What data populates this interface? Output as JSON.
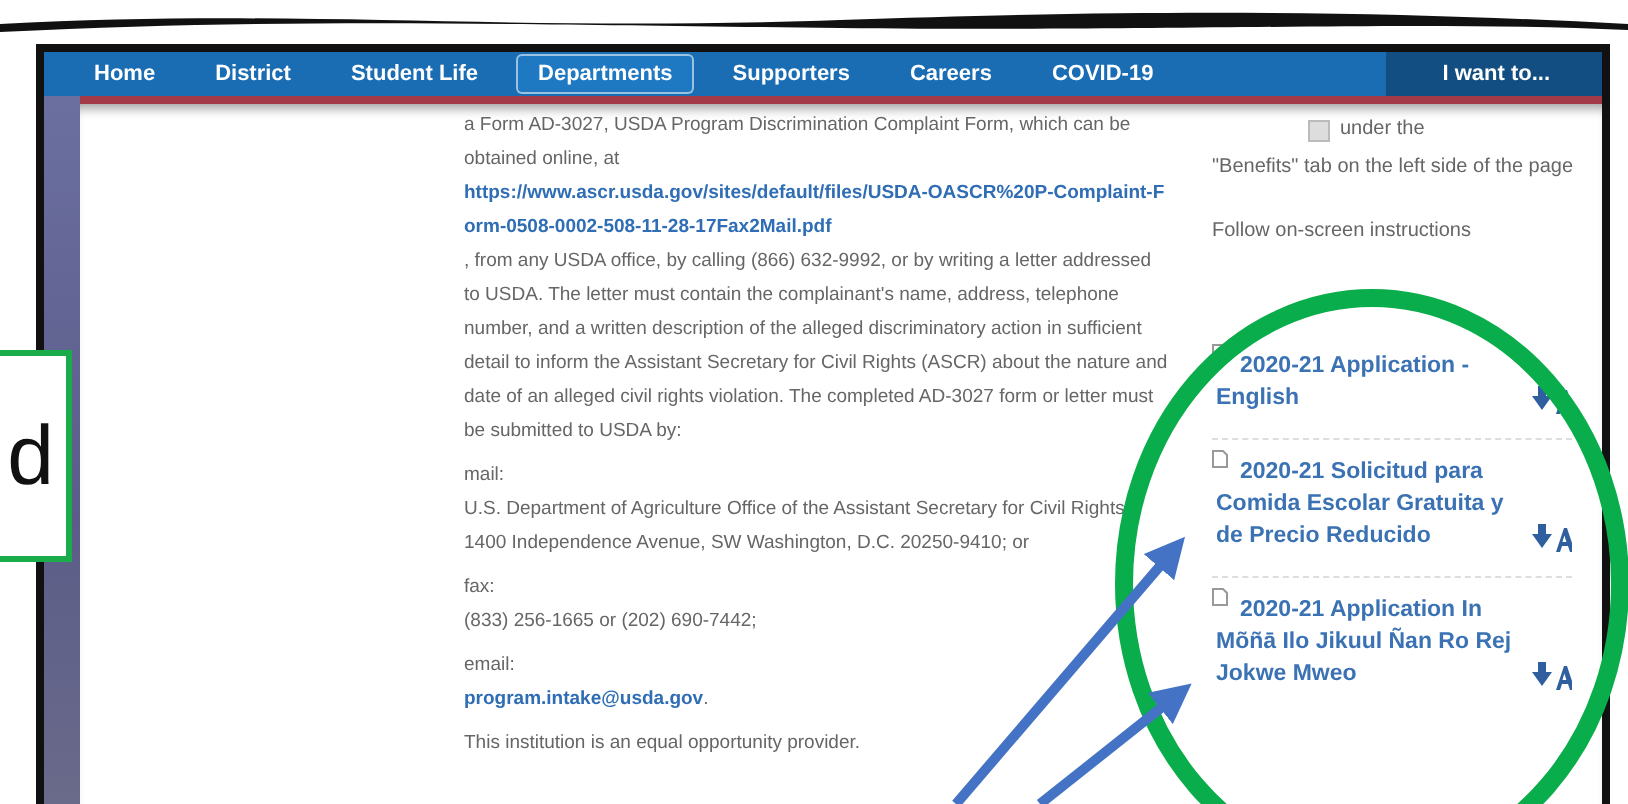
{
  "nav": {
    "items": [
      {
        "label": "Home",
        "selected": false
      },
      {
        "label": "District",
        "selected": false
      },
      {
        "label": "Student Life",
        "selected": false
      },
      {
        "label": "Departments",
        "selected": true
      },
      {
        "label": "Supporters",
        "selected": false
      },
      {
        "label": "Careers",
        "selected": false
      },
      {
        "label": "COVID-19",
        "selected": false
      }
    ],
    "menu_button": "I want to..."
  },
  "main": {
    "intro": {
      "text_before": "a Form AD-3027, USDA Program Discrimination Complaint Form, which can be obtained online, at",
      "link": "https://www.ascr.usda.gov/sites/default/files/USDA-OASCR%20P-Complaint-Form-0508-0002-508-11-28-17Fax2Mail.pdf",
      "text_after": ", from any USDA office, by calling (866) 632-9992, or by writing a letter addressed to USDA. The letter must contain the complainant's name, address, telephone number, and a written description of the alleged discriminatory action in sufficient detail to inform the Assistant Secretary for Civil Rights (ASCR) about the nature and date of an alleged civil rights violation.  The completed AD-3027 form or letter must be submitted to USDA by:"
    },
    "contacts": [
      {
        "label": "mail:",
        "kind": "text",
        "value": "U.S. Department of Agriculture  Office of the Assistant Secretary for Civil Rights  1400 Independence Avenue, SW  Washington, D.C. 20250-9410; or"
      },
      {
        "label": "fax:",
        "kind": "text",
        "value": "(833) 256-1665 or (202) 690-7442;"
      },
      {
        "label": "email:",
        "kind": "link",
        "value": "program.intake@usda.gov",
        "suffix": "."
      }
    ],
    "closing": "This institution is an equal opportunity provider."
  },
  "sidebar": {
    "step_text": "under the",
    "step_text_2": "\"Benefits\" tab on the left side of the page",
    "instructions": "Follow on-screen instructions",
    "downloads": [
      {
        "title": "2020-21 Application - English"
      },
      {
        "title": "2020-21 Solicitud para Comida Escolar Gratuita y de Precio Reducido"
      },
      {
        "title": "2020-21 Application In Mõñā Ilo Jikuul Ñan Ro Rej Jokwe Mweo"
      }
    ]
  },
  "annotations": {
    "callout_text": "d"
  }
}
